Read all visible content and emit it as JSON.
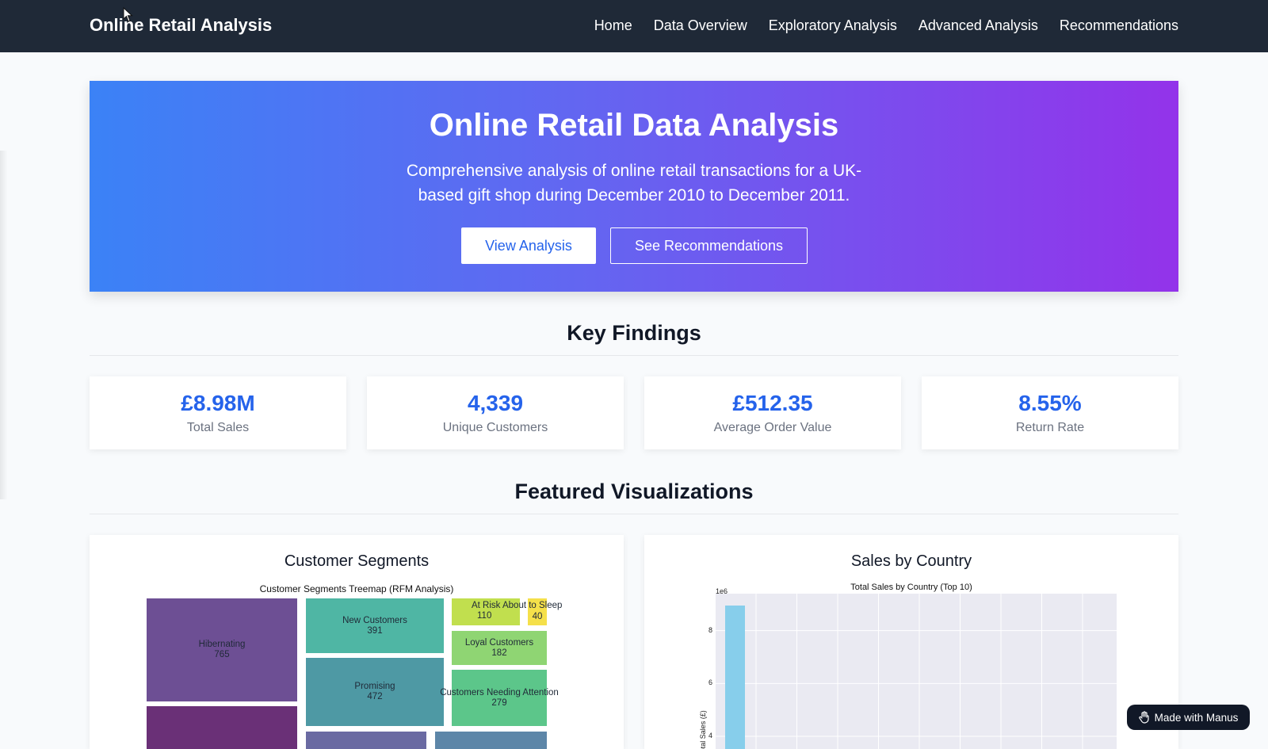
{
  "nav": {
    "brand": "Online Retail Analysis",
    "links": [
      "Home",
      "Data Overview",
      "Exploratory Analysis",
      "Advanced Analysis",
      "Recommendations"
    ]
  },
  "hero": {
    "title": "Online Retail Data Analysis",
    "description": "Comprehensive analysis of online retail transactions for a UK-based gift shop during December 2010 to December 2011.",
    "primary_button": "View Analysis",
    "secondary_button": "See Recommendations"
  },
  "key_findings": {
    "title": "Key Findings",
    "items": [
      {
        "value": "£8.98M",
        "label": "Total Sales"
      },
      {
        "value": "4,339",
        "label": "Unique Customers"
      },
      {
        "value": "£512.35",
        "label": "Average Order Value"
      },
      {
        "value": "8.55%",
        "label": "Return Rate"
      }
    ]
  },
  "featured": {
    "title": "Featured Visualizations",
    "segments_card": {
      "title": "Customer Segments",
      "treemap_title": "Customer Segments Treemap (RFM Analysis)",
      "segments": [
        {
          "name": "Hibernating",
          "count": "765",
          "color": "#6d4f94"
        },
        {
          "name": "New Customers",
          "count": "391",
          "color": "#4fb6a4"
        },
        {
          "name": "Promising",
          "count": "472",
          "color": "#4e99a4"
        },
        {
          "name": "At Risk About to Sleep",
          "count": "110",
          "color": "#c1df4e"
        },
        {
          "name": "",
          "count": "40",
          "color": "#f5e04a"
        },
        {
          "name": "Loyal Customers",
          "count": "182",
          "color": "#8fd573"
        },
        {
          "name": "Customers Needing Attention",
          "count": "279",
          "color": "#5cc68a"
        }
      ],
      "extra_colors": [
        "#6a3077",
        "#6a6aa2",
        "#5d86a8"
      ]
    },
    "country_card": {
      "title": "Sales by Country",
      "chart_data": {
        "type": "bar",
        "title": "Total Sales by Country (Top 10)",
        "ylabel": "Total Sales (£)",
        "y_scale_label": "1e6",
        "yticks": [
          4,
          6,
          8
        ],
        "values": [
          8.95
        ],
        "bar_color": "#87ceeb",
        "ylim": [
          3.4,
          9.4
        ]
      }
    }
  },
  "badge": {
    "label": "Made with Manus"
  }
}
